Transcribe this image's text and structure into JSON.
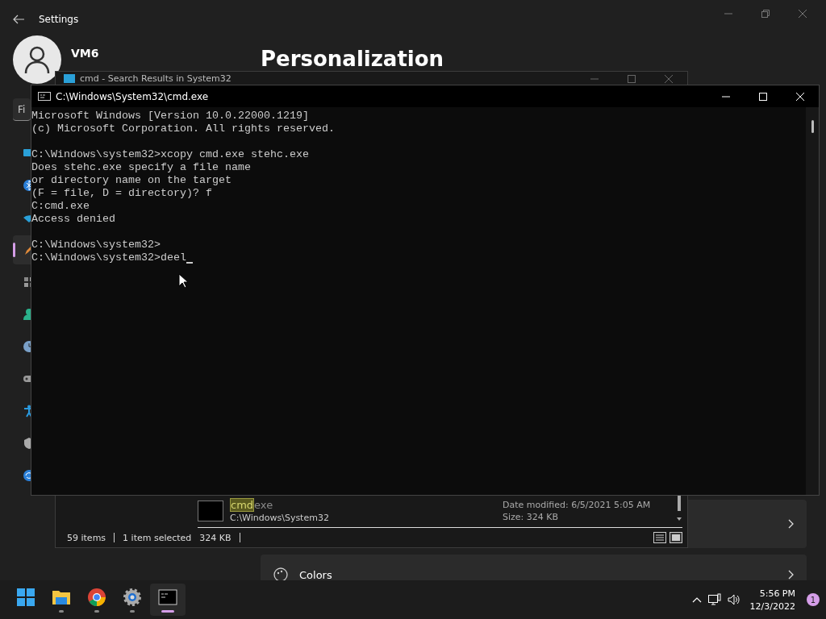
{
  "settings": {
    "title": "Settings",
    "user": "VM6",
    "search": {
      "placeholder": "Fi"
    },
    "heading": "Personalization",
    "nav": [
      {
        "kind": "system",
        "selected": false
      },
      {
        "kind": "bluetooth",
        "selected": false
      },
      {
        "kind": "network",
        "selected": false
      },
      {
        "kind": "personalization",
        "selected": true
      },
      {
        "kind": "apps",
        "selected": false
      },
      {
        "kind": "accounts",
        "selected": false
      },
      {
        "kind": "time",
        "selected": false
      },
      {
        "kind": "gaming",
        "selected": false
      },
      {
        "kind": "accessibility",
        "selected": false
      },
      {
        "kind": "privacy",
        "selected": false
      },
      {
        "kind": "update",
        "selected": false
      }
    ],
    "cards": [
      {
        "kind": "plain"
      },
      {
        "kind": "colors",
        "label": "Colors"
      }
    ]
  },
  "explorer": {
    "title": "cmd - Search Results in System32",
    "result": {
      "match": "cmd",
      "rest": "exe",
      "path": "C:\\Windows\\System32",
      "modified": "Date modified: 6/5/2021 5:05 AM",
      "size": "Size: 324 KB"
    },
    "status": {
      "count": "59 items",
      "selection": "1 item selected",
      "selection_size": "324 KB"
    }
  },
  "console": {
    "title": "C:\\Windows\\System32\\cmd.exe",
    "blocks": [
      [
        "Microsoft Windows [Version 10.0.22000.1219]",
        "(c) Microsoft Corporation. All rights reserved."
      ],
      [
        "C:\\Windows\\system32>xcopy cmd.exe stehc.exe",
        "Does stehc.exe specify a file name",
        "or directory name on the target",
        "(F = file, D = directory)? f",
        "C:cmd.exe",
        "Access denied"
      ],
      [
        "C:\\Windows\\system32>",
        "C:\\Windows\\system32>deel"
      ]
    ]
  },
  "taskbar": {
    "apps": [
      {
        "kind": "start",
        "active": false,
        "running": false
      },
      {
        "kind": "explorer",
        "active": false,
        "running": true
      },
      {
        "kind": "chrome",
        "active": false,
        "running": true
      },
      {
        "kind": "settings",
        "active": false,
        "running": true
      },
      {
        "kind": "terminal",
        "active": true,
        "running": true
      }
    ],
    "time": "5:56 PM",
    "date": "12/3/2022",
    "notifications": "1"
  }
}
